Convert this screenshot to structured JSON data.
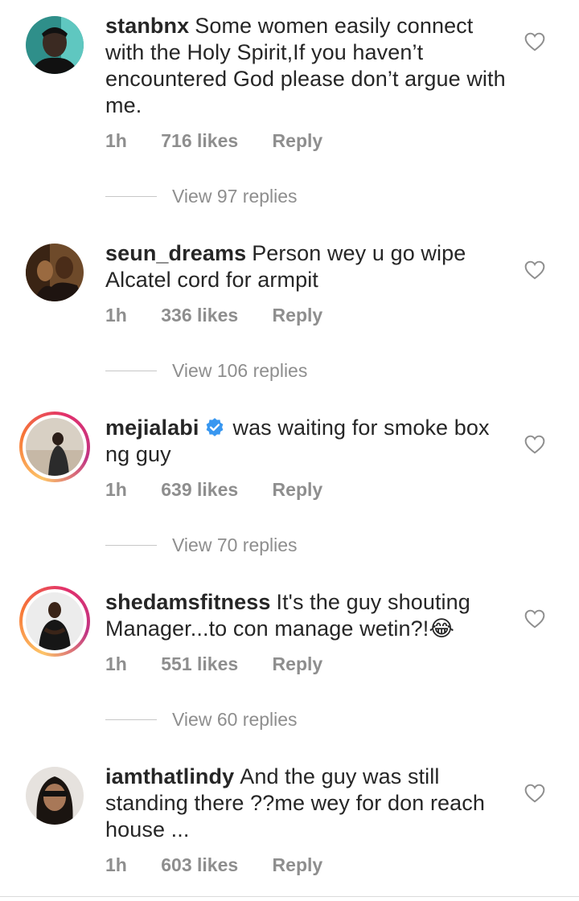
{
  "comments": [
    {
      "username": "stanbnx",
      "text": "Some women easily connect with the Holy Spirit,If you haven’t encountered God please don’t argue with me.",
      "time": "1h",
      "likes": "716 likes",
      "reply": "Reply",
      "view_replies": "View 97 replies",
      "story_ring": false,
      "verified": false
    },
    {
      "username": "seun_dreams",
      "text": "Person wey u go wipe Alcatel cord for armpit",
      "time": "1h",
      "likes": "336 likes",
      "reply": "Reply",
      "view_replies": "View 106 replies",
      "story_ring": false,
      "verified": false
    },
    {
      "username": "mejialabi",
      "text": "was waiting for smoke box ng guy",
      "time": "1h",
      "likes": "639 likes",
      "reply": "Reply",
      "view_replies": "View 70 replies",
      "story_ring": true,
      "verified": true
    },
    {
      "username": "shedamsfitness",
      "text": "It's the guy shouting Manager...to con manage wetin?!😂",
      "time": "1h",
      "likes": "551 likes",
      "reply": "Reply",
      "view_replies": "View 60 replies",
      "story_ring": true,
      "verified": false
    },
    {
      "username": "iamthatlindy",
      "text": "And the guy was still standing there ??me wey for don reach house ...",
      "time": "1h",
      "likes": "603 likes",
      "reply": "Reply",
      "story_ring": false,
      "verified": false
    }
  ],
  "colors": {
    "text": "#262626",
    "secondary": "#8e8e8e",
    "verified_blue": "#3897f0"
  },
  "icons": {
    "like": "heart-outline-icon",
    "verified": "verified-badge-icon"
  }
}
